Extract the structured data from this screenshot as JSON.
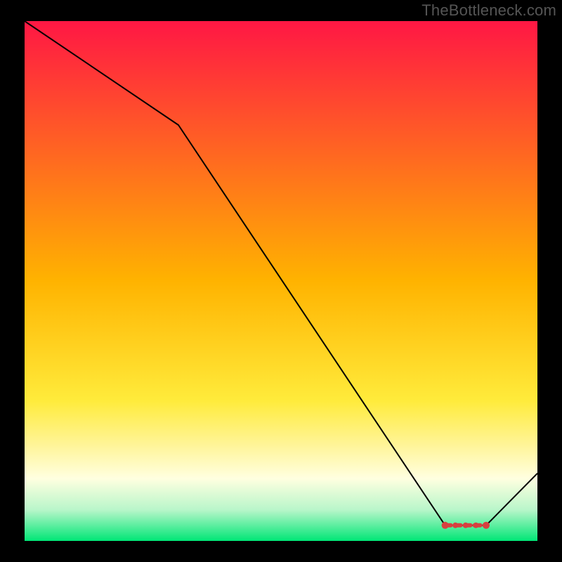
{
  "attribution": "TheBottleneck.com",
  "chart_data": {
    "type": "line",
    "title": "",
    "xlabel": "",
    "ylabel": "",
    "xlim": [
      0,
      100
    ],
    "ylim": [
      0,
      100
    ],
    "x": [
      0,
      30,
      82,
      90,
      100
    ],
    "values": [
      100,
      80,
      3,
      3,
      13
    ],
    "gradient_stops": [
      {
        "offset": 0.0,
        "color": "#ff1744"
      },
      {
        "offset": 0.5,
        "color": "#ffb300"
      },
      {
        "offset": 0.73,
        "color": "#ffeb3b"
      },
      {
        "offset": 0.82,
        "color": "#fff59d"
      },
      {
        "offset": 0.88,
        "color": "#ffffe0"
      },
      {
        "offset": 0.94,
        "color": "#b9f6ca"
      },
      {
        "offset": 1.0,
        "color": "#00e676"
      }
    ],
    "markers": {
      "x": [
        82,
        84,
        86,
        88,
        90
      ],
      "y": [
        3,
        3,
        3,
        3,
        3
      ],
      "color": "#d84040",
      "stroke": "#d84040",
      "radius": 4
    }
  }
}
